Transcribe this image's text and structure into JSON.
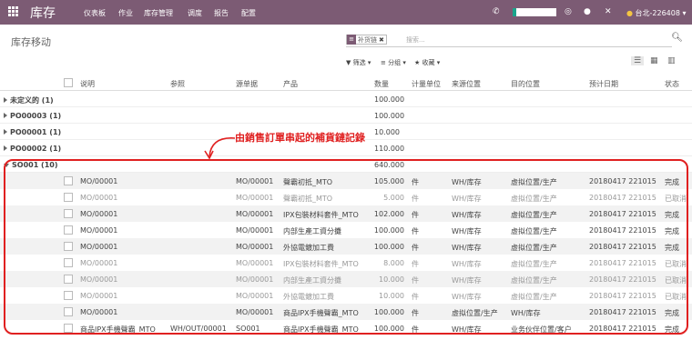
{
  "topbar": {
    "app_title": "库存",
    "menu": [
      "仪表板",
      "作业",
      "库存管理",
      "调度",
      "报告",
      "配置"
    ],
    "user": "台北-226408 ▾",
    "icons": [
      "phone-icon",
      "chat-icon",
      "close-icon",
      "user-icon"
    ]
  },
  "control": {
    "breadcrumb": "库存移动",
    "facet_label": "补货链",
    "search_placeholder": "搜索...",
    "filters": "▼ 筛选 ▾",
    "groupby": "≡ 分组 ▾",
    "favorites": "★ 收藏 ▾"
  },
  "annotation": "由銷售訂單串起的補貨鏈記錄",
  "columns": [
    "说明",
    "参照",
    "源单据",
    "产品",
    "数量",
    "计量单位",
    "来源位置",
    "目的位置",
    "预计日期",
    "状态"
  ],
  "groups": [
    {
      "name": "未定义的 (1)",
      "qty": "100.000"
    },
    {
      "name": "PO00003 (1)",
      "qty": "100.000"
    },
    {
      "name": "PO00001 (1)",
      "qty": "10.000"
    },
    {
      "name": "PO00002 (1)",
      "qty": "110.000"
    },
    {
      "name": "SO001 (10)",
      "qty": "640.000"
    }
  ],
  "rows": [
    {
      "desc": "MO/00001",
      "ref": "",
      "src": "MO/00001",
      "product": "聲霸初抵_MTO",
      "qty": "105.000",
      "uom": "件",
      "from": "WH/库存",
      "to": "虚拟位置/生产",
      "date": "20180417 221015",
      "state": "完成"
    },
    {
      "desc": "MO/00001",
      "ref": "",
      "src": "MO/00001",
      "product": "聲霸初抵_MTO",
      "qty": "5.000",
      "uom": "件",
      "from": "WH/库存",
      "to": "虚拟位置/生产",
      "date": "20180417 221015",
      "state": "已取消"
    },
    {
      "desc": "MO/00001",
      "ref": "",
      "src": "MO/00001",
      "product": "IPX包裝材料套件_MTO",
      "qty": "102.000",
      "uom": "件",
      "from": "WH/库存",
      "to": "虚拟位置/生产",
      "date": "20180417 221015",
      "state": "完成"
    },
    {
      "desc": "MO/00001",
      "ref": "",
      "src": "MO/00001",
      "product": "内部生產工資分攤",
      "qty": "100.000",
      "uom": "件",
      "from": "WH/库存",
      "to": "虚拟位置/生产",
      "date": "20180417 221015",
      "state": "完成"
    },
    {
      "desc": "MO/00001",
      "ref": "",
      "src": "MO/00001",
      "product": "外協電鍍加工費",
      "qty": "100.000",
      "uom": "件",
      "from": "WH/库存",
      "to": "虚拟位置/生产",
      "date": "20180417 221015",
      "state": "完成"
    },
    {
      "desc": "MO/00001",
      "ref": "",
      "src": "MO/00001",
      "product": "IPX包裝材料套件_MTO",
      "qty": "8.000",
      "uom": "件",
      "from": "WH/库存",
      "to": "虚拟位置/生产",
      "date": "20180417 221015",
      "state": "已取消"
    },
    {
      "desc": "MO/00001",
      "ref": "",
      "src": "MO/00001",
      "product": "内部生產工資分攤",
      "qty": "10.000",
      "uom": "件",
      "from": "WH/库存",
      "to": "虚拟位置/生产",
      "date": "20180417 221015",
      "state": "已取消"
    },
    {
      "desc": "MO/00001",
      "ref": "",
      "src": "MO/00001",
      "product": "外協電鍍加工費",
      "qty": "10.000",
      "uom": "件",
      "from": "WH/库存",
      "to": "虚拟位置/生产",
      "date": "20180417 221015",
      "state": "已取消"
    },
    {
      "desc": "MO/00001",
      "ref": "",
      "src": "MO/00001",
      "product": "商品IPX手機聲霸_MTO",
      "qty": "100.000",
      "uom": "件",
      "from": "虚拟位置/生产",
      "to": "WH/库存",
      "date": "20180417 221015",
      "state": "完成"
    },
    {
      "desc": "商品IPX手機聲霸_MTO",
      "ref": "WH/OUT/00001",
      "src": "SO001",
      "product": "商品IPX手機聲霸_MTO",
      "qty": "100.000",
      "uom": "件",
      "from": "WH/库存",
      "to": "业务伙伴位置/客户",
      "date": "20180417 221015",
      "state": "完成"
    }
  ],
  "colors": {
    "topbar": "#7c5b74",
    "annotation": "#e02020"
  }
}
